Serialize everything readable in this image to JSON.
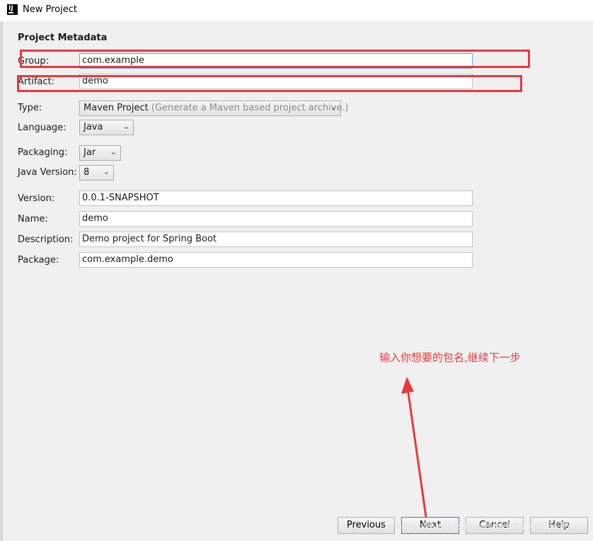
{
  "window": {
    "title": "New Project",
    "app_icon": "IJ"
  },
  "section": {
    "title": "Project Metadata"
  },
  "fields": {
    "group": {
      "label": "Group:",
      "value": "com.example"
    },
    "artifact": {
      "label": "Artifact:",
      "value": "demo"
    },
    "type": {
      "label": "Type:",
      "value": "Maven Project",
      "hint": "(Generate a Maven based project archive.)"
    },
    "language": {
      "label": "Language:",
      "value": "Java"
    },
    "packaging": {
      "label": "Packaging:",
      "value": "Jar"
    },
    "java_version": {
      "label": "Java Version:",
      "value": "8"
    },
    "version": {
      "label": "Version:",
      "value": "0.0.1-SNAPSHOT"
    },
    "name": {
      "label": "Name:",
      "value": "demo"
    },
    "description": {
      "label": "Description:",
      "value": "Demo project for Spring Boot"
    },
    "package": {
      "label": "Package:",
      "value": "com.example.demo"
    }
  },
  "annotation": {
    "text": "输入你想要的包名,继续下一步",
    "color": "#e63a3a"
  },
  "buttons": {
    "previous": "Previous",
    "next": "Next",
    "cancel": "Cancel",
    "help": "Help"
  },
  "watermark": "https://blog.csdn.net/weixin_44624366",
  "icons": {
    "dropdown": "chevron-down-icon"
  }
}
